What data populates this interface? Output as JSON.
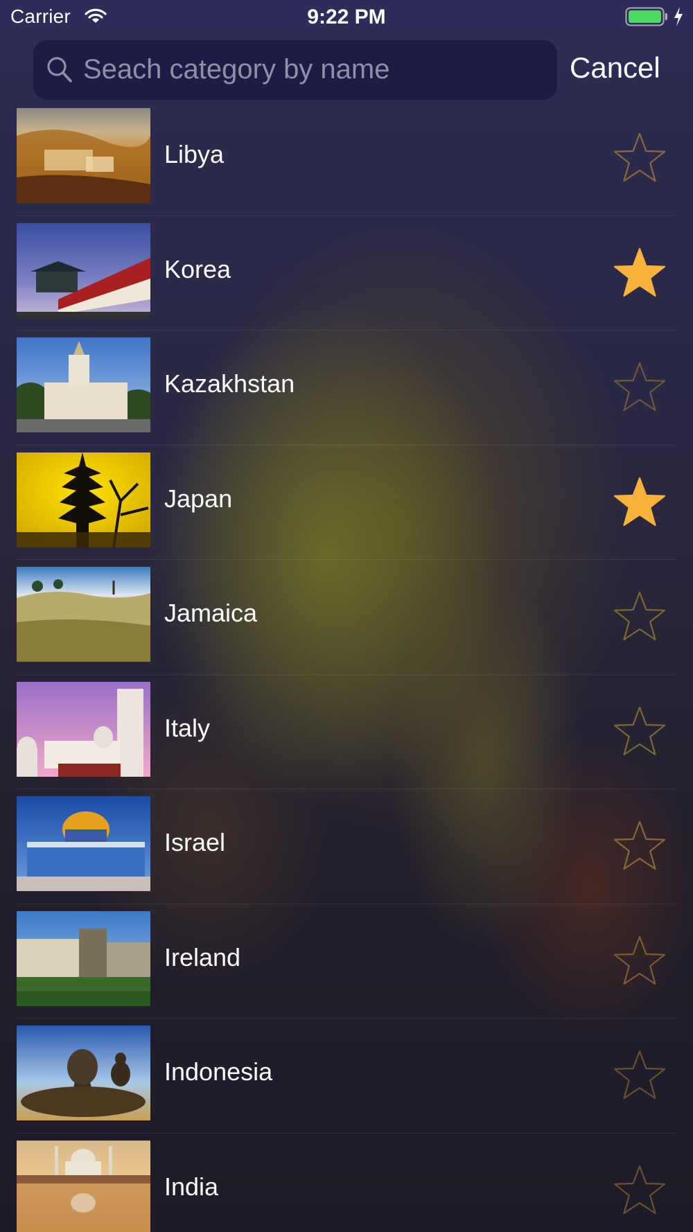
{
  "status_bar": {
    "carrier": "Carrier",
    "time": "9:22 PM",
    "icons": [
      "wifi-icon",
      "battery-icon",
      "charging-bolt-icon"
    ],
    "battery_color": "#4cd964"
  },
  "search": {
    "placeholder": "Seach category by name",
    "cancel_label": "Cancel",
    "icon": "search-icon"
  },
  "colors": {
    "star_filled": "#f6b23a",
    "star_outline": "#8a6a3a",
    "search_field_bg": "#1c1c45"
  },
  "categories": [
    {
      "name": "Libya",
      "favorite": false,
      "image": "libya-photo"
    },
    {
      "name": "Korea",
      "favorite": true,
      "image": "korea-photo"
    },
    {
      "name": "Kazakhstan",
      "favorite": false,
      "image": "kazakhstan-photo"
    },
    {
      "name": "Japan",
      "favorite": true,
      "image": "japan-photo"
    },
    {
      "name": "Jamaica",
      "favorite": false,
      "image": "jamaica-photo"
    },
    {
      "name": "Italy",
      "favorite": false,
      "image": "italy-photo"
    },
    {
      "name": "Israel",
      "favorite": false,
      "image": "israel-photo"
    },
    {
      "name": "Ireland",
      "favorite": false,
      "image": "ireland-photo"
    },
    {
      "name": "Indonesia",
      "favorite": false,
      "image": "indonesia-photo"
    },
    {
      "name": "India",
      "favorite": false,
      "image": "india-photo"
    }
  ]
}
